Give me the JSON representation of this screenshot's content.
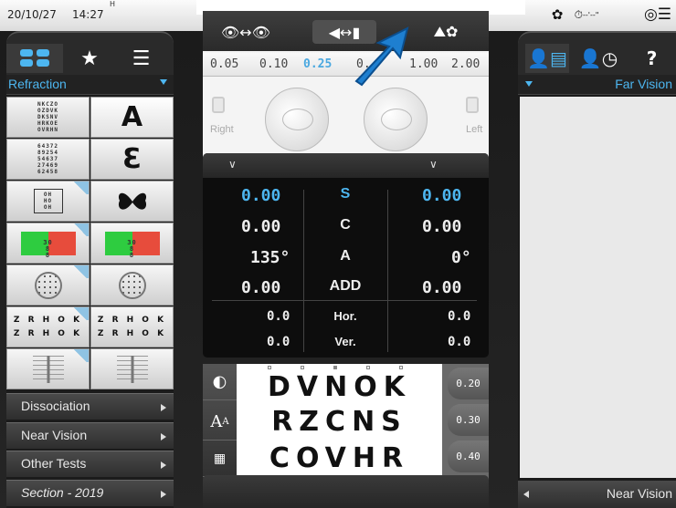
{
  "status": {
    "date": "20/10/27",
    "time": "14:27",
    "hmark": "H",
    "timer": "--'--\""
  },
  "left_panel": {
    "dropdown": "Refraction",
    "tiles": [
      {
        "kind": "text-chart",
        "text": "NKCZO OZDVK DKSNV HRKOE OVRHN"
      },
      {
        "kind": "big",
        "text": "A"
      },
      {
        "kind": "text-chart",
        "text": "64372 89254 54637 27469 62458"
      },
      {
        "kind": "big",
        "text": "Ɛ"
      },
      {
        "kind": "icon",
        "text": "OH HO OH"
      },
      {
        "kind": "big",
        "text": "butterfly"
      },
      {
        "kind": "icon",
        "text": "30 8 8"
      },
      {
        "kind": "icon",
        "text": "30 8 8"
      },
      {
        "kind": "icon",
        "text": "dots"
      },
      {
        "kind": "icon",
        "text": "dots"
      },
      {
        "kind": "letters",
        "text": "Z R H O K"
      },
      {
        "kind": "letters",
        "text": "Z R H O K"
      },
      {
        "kind": "icon",
        "text": "cross"
      },
      {
        "kind": "icon",
        "text": "cross"
      }
    ],
    "menus": [
      "Dissociation",
      "Near Vision",
      "Other Tests",
      "Section - 2019"
    ]
  },
  "center_top": {
    "scale": [
      "0.05",
      "0.10",
      "0.25",
      "0.",
      "1.00",
      "2.00"
    ],
    "active_index": 2,
    "right_label": "Right",
    "left_label": "Left"
  },
  "center_mid": {
    "rows": [
      {
        "r": "0.00",
        "label": "S",
        "l": "0.00",
        "hl": true
      },
      {
        "r": "0.00",
        "label": "C",
        "l": "0.00"
      },
      {
        "r": "135°",
        "label": "A",
        "l": "0°"
      },
      {
        "r": "0.00",
        "label": "ADD",
        "l": "0.00"
      },
      {
        "r": "0.0",
        "label": "Hor.",
        "l": "0.0"
      },
      {
        "r": "0.0",
        "label": "Ver.",
        "l": "0.0"
      }
    ]
  },
  "center_bot": {
    "lines": [
      "DVNOK",
      "RZCNS",
      "COVHR"
    ],
    "acuity": [
      "0.20",
      "0.30",
      "0.40"
    ]
  },
  "right_panel": {
    "dropdown": "Far Vision",
    "footer": "Near Vision"
  },
  "colors": {
    "accent": "#4db6f0",
    "highlight": "#4aa8e0"
  }
}
